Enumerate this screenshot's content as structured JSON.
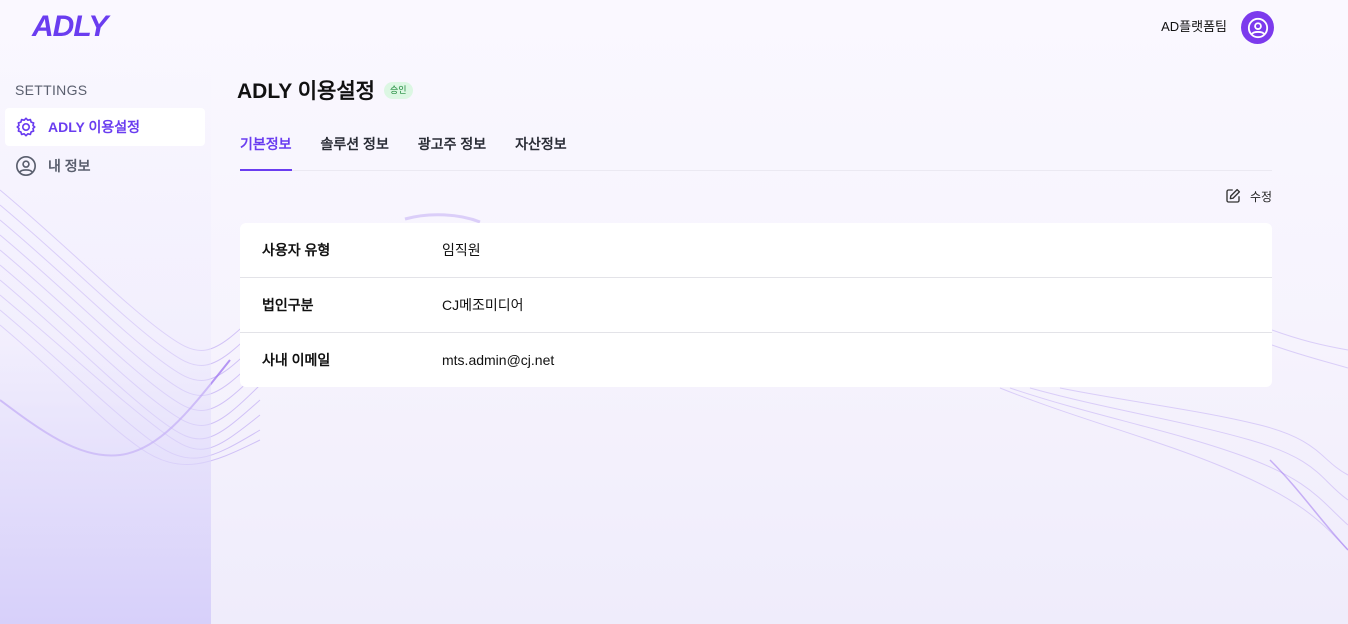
{
  "header": {
    "logo": "ADLY",
    "user_name": "AD플랫폼팀",
    "avatar_icon": "user-circle-icon"
  },
  "sidebar": {
    "heading": "SETTINGS",
    "items": [
      {
        "label": "ADLY 이용설정",
        "icon": "gear-icon",
        "active": true
      },
      {
        "label": "내 정보",
        "icon": "user-circle-icon",
        "active": false
      }
    ]
  },
  "main": {
    "title": "ADLY 이용설정",
    "status_badge": "승인",
    "tabs": [
      {
        "label": "기본정보",
        "active": true
      },
      {
        "label": "솔루션 정보",
        "active": false
      },
      {
        "label": "광고주 정보",
        "active": false
      },
      {
        "label": "자산정보",
        "active": false
      }
    ],
    "edit_label": "수정",
    "info_rows": [
      {
        "label": "사용자 유형",
        "value": "임직원"
      },
      {
        "label": "법인구분",
        "value": "CJ메조미디어"
      },
      {
        "label": "사내 이메일",
        "value": "mts.admin@cj.net"
      }
    ]
  },
  "colors": {
    "brand": "#6a3df0",
    "avatar": "#7c3aed",
    "badge_bg": "#dcf7e3",
    "badge_text": "#1f8a3c"
  }
}
